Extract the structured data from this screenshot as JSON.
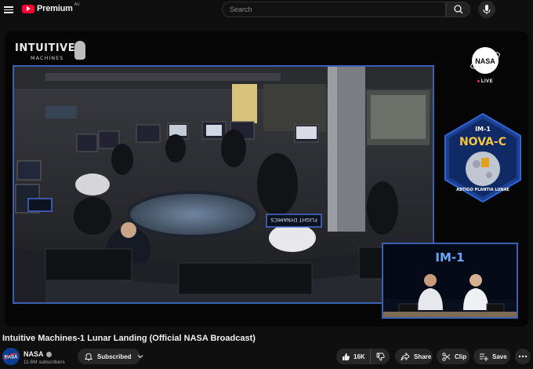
{
  "header": {
    "brand": "Premium",
    "region": "AU",
    "search_placeholder": "Search"
  },
  "player": {
    "overlay_logo_line1": "INTUITIVE",
    "overlay_logo_line2": "MACHINES",
    "nasa_logo_text": "NASA",
    "live_label": "LIVE",
    "mission_patch": {
      "top": "IM-1",
      "name": "NOVA-C",
      "motto": "ADTIGO PLANTIA LUNAE"
    },
    "monitor_sign": "FLIGHT DYNAMICS",
    "pip_title": "IM-1"
  },
  "video": {
    "title": "Intuitive Machines-1 Lunar Landing (Official NASA Broadcast)"
  },
  "channel": {
    "name": "NASA",
    "subscribers": "11.6M subscribers",
    "subscribe_label": "Subscribed"
  },
  "actions": {
    "likes": "16K",
    "share": "Share",
    "clip": "Clip",
    "save": "Save"
  },
  "colors": {
    "youtube_red": "#ff0033",
    "frame_blue": "#3a5fb3",
    "background": "#0f0f0f"
  }
}
